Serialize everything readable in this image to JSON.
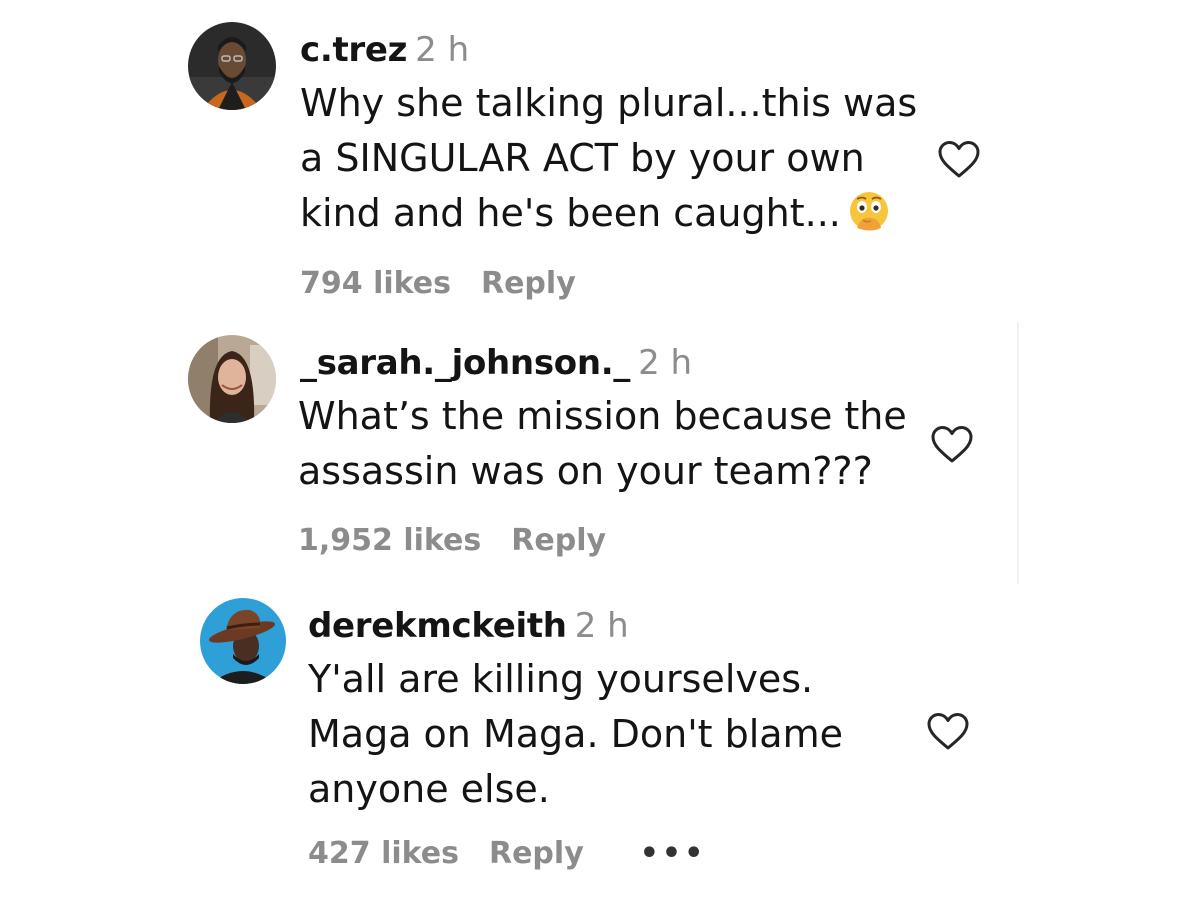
{
  "comments": [
    {
      "username": "c.trez",
      "time": "2 h",
      "lines": [
        "Why she talking plural...this was",
        "a SINGULAR ACT by your own",
        "kind and he's been caught..."
      ],
      "emoji": "face-with-hand-over-mouth-emoji",
      "likes": "794 likes",
      "reply": "Reply"
    },
    {
      "username": "_sarah._johnson._",
      "time": "2 h",
      "lines": [
        "What’s the mission because the",
        "assassin was on your team???"
      ],
      "likes": "1,952 likes",
      "reply": "Reply"
    },
    {
      "username": "derekmckeith",
      "time": "2 h",
      "lines": [
        "Y'all are killing yourselves.",
        "Maga on Maga. Don't blame",
        "anyone else."
      ],
      "likes": "427 likes",
      "reply": "Reply",
      "more": "•••"
    }
  ],
  "icons": {
    "like": "heart-outline-icon",
    "more": "more-options-icon"
  },
  "colors": {
    "text": "#141414",
    "muted": "#8c8c8c"
  }
}
